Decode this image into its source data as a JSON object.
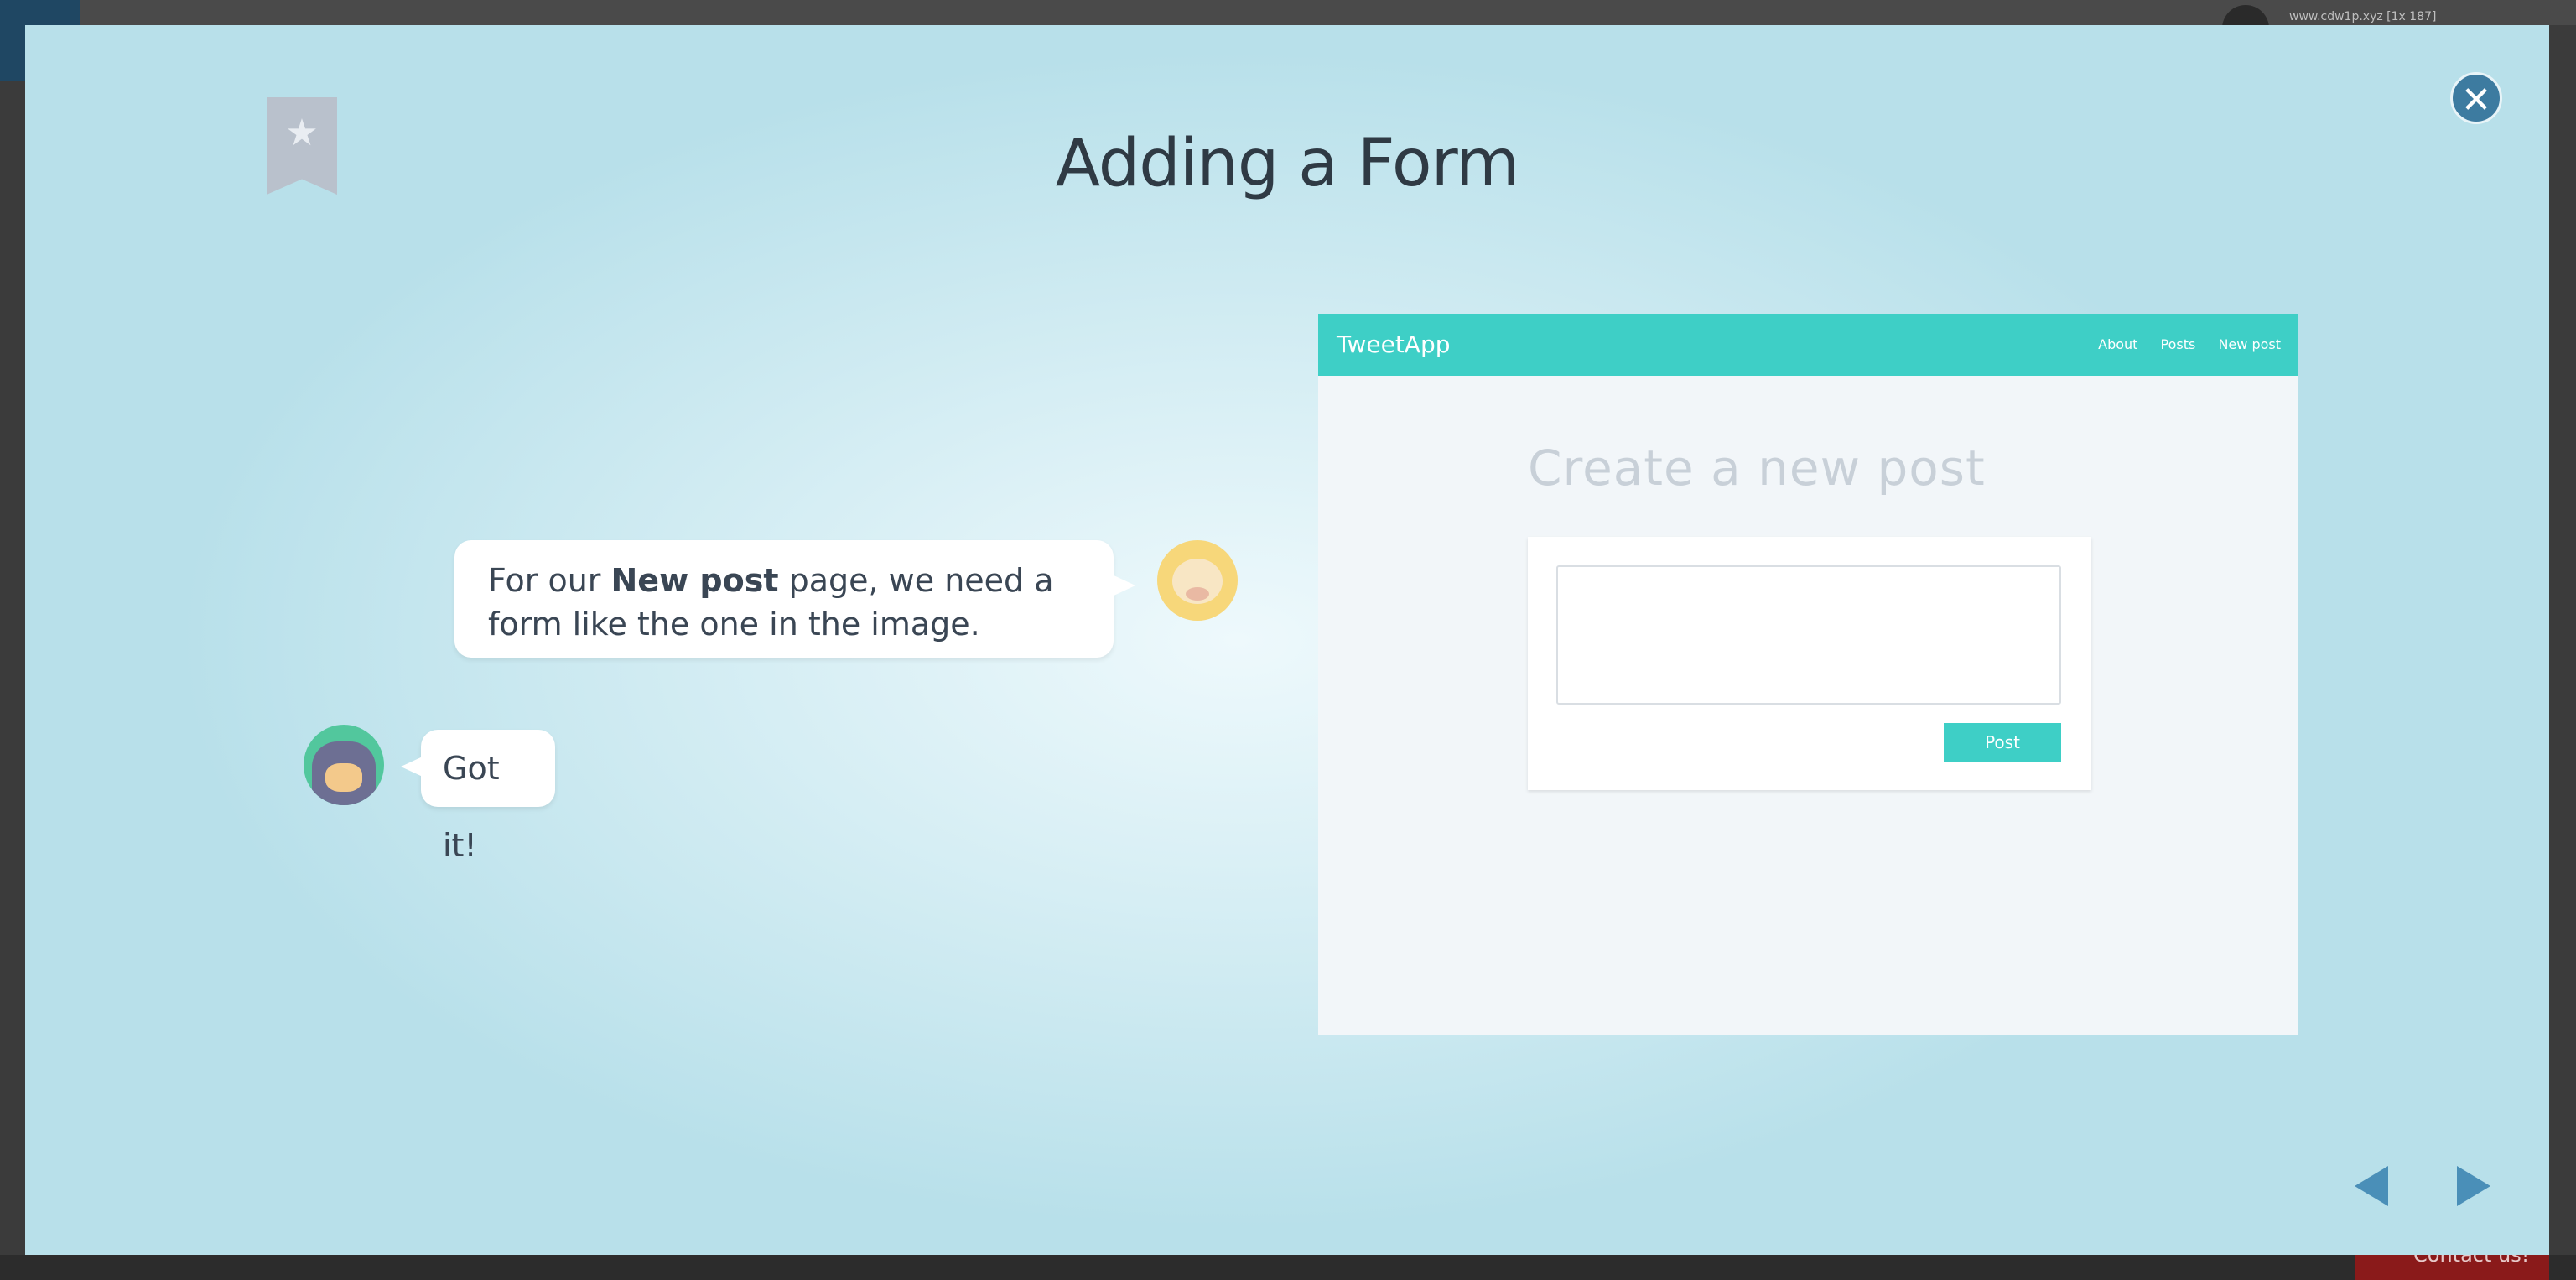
{
  "backdrop": {
    "url_text": "www.cdw1p.xyz [1x 187]",
    "contact_label": "Contact us!"
  },
  "modal": {
    "title": "Adding a Form",
    "bookmark_icon": "star-icon",
    "close_icon": "close-icon"
  },
  "chat": {
    "teacher": {
      "text_before": "For our ",
      "text_bold": "New post",
      "text_after": " page, we need a form like the one in the image."
    },
    "student": {
      "text": "Got it!"
    }
  },
  "preview": {
    "brand": "TweetApp",
    "nav_links": [
      "About",
      "Posts",
      "New post"
    ],
    "heading": "Create a new post",
    "button_label": "Post",
    "accent_color": "#3ecfc6"
  },
  "navigation": {
    "prev_icon": "triangle-left-icon",
    "next_icon": "triangle-right-icon"
  }
}
